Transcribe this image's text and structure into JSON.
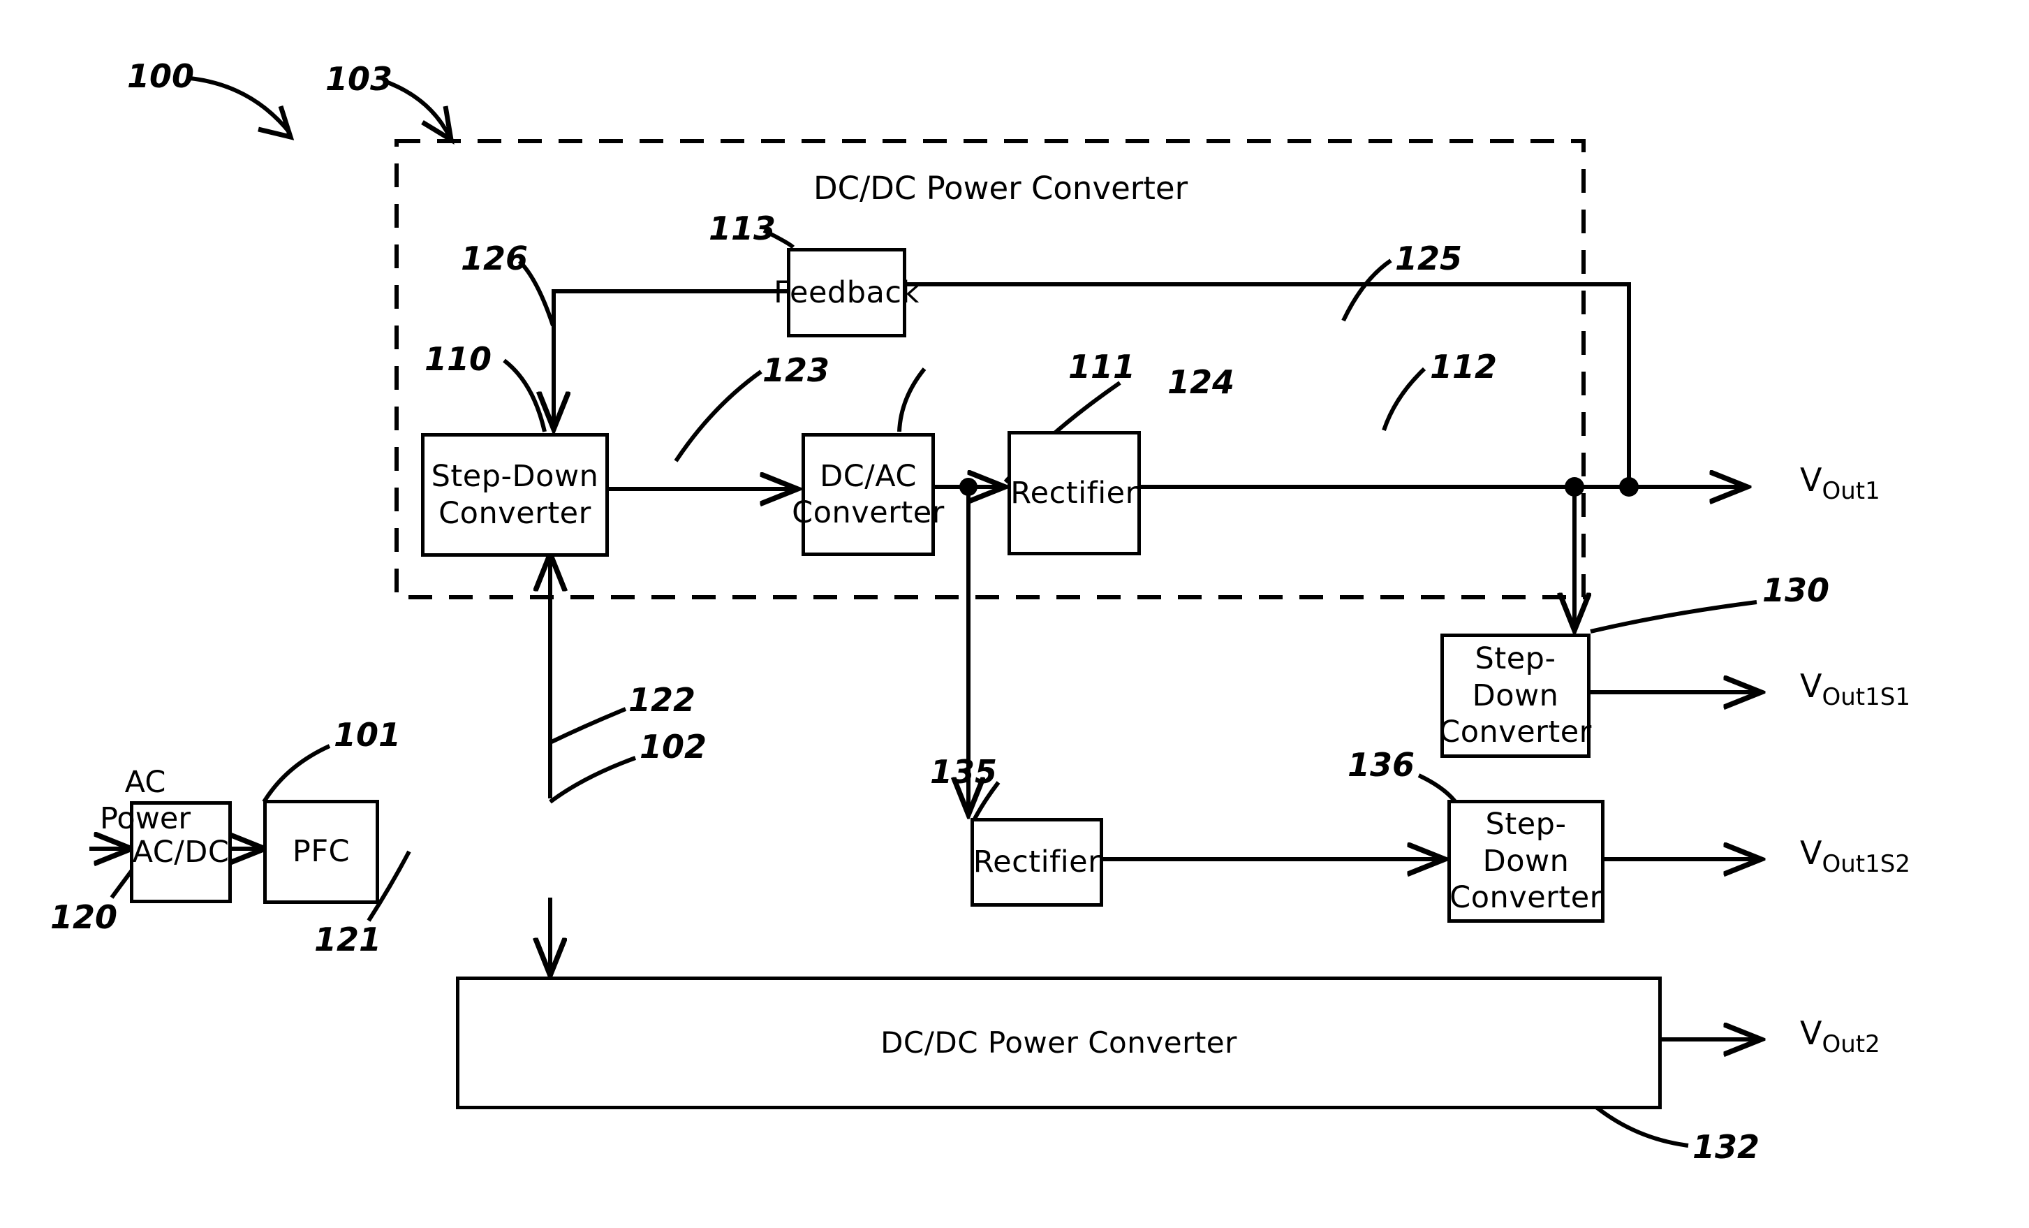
{
  "figure": {
    "kind": "patent-block-diagram",
    "ref_100": "100",
    "ref_103": "103"
  },
  "dashed_module": {
    "title": "DC/DC Power Converter",
    "ref": "103"
  },
  "blocks": {
    "feedback": {
      "label": "Feedback",
      "ref": "113"
    },
    "stepdown110": {
      "label": "Step-Down\nConverter",
      "line1": "Step-Down",
      "line2": "Converter",
      "ref": "110"
    },
    "dcac111": {
      "label": "DC/AC\nConverter",
      "line1": "DC/AC",
      "line2": "Converter",
      "ref": "111"
    },
    "rectifier112": {
      "label": "Rectifier",
      "ref": "112"
    },
    "stepdown130": {
      "line1": "Step-Down",
      "line2": "Converter",
      "ref": "130"
    },
    "acdc101": {
      "label": "AC/DC",
      "ref": "101"
    },
    "pfc102": {
      "label": "PFC",
      "ref": "102"
    },
    "rectifier135": {
      "label": "Rectifier",
      "ref": "135"
    },
    "stepdown136": {
      "line1": "Step-Down",
      "line2": "Converter",
      "ref": "136"
    },
    "dcdc132": {
      "label": "DC/DC Power Converter",
      "ref": "132"
    }
  },
  "signals": {
    "ac_power_line1": "AC",
    "ac_power_line2": "Power",
    "ref_120": "120",
    "ref_121": "121",
    "ref_122": "122",
    "ref_123": "123",
    "ref_124": "124",
    "ref_125": "125",
    "ref_126": "126"
  },
  "outputs": {
    "vout1": {
      "symbol": "V",
      "sub": "Out1"
    },
    "vout1s1": {
      "symbol": "V",
      "sub": "Out1S1"
    },
    "vout1s2": {
      "symbol": "V",
      "sub": "Out1S2"
    },
    "vout2": {
      "symbol": "V",
      "sub": "Out2"
    }
  },
  "colors": {
    "ink": "#000000",
    "paper": "#ffffff"
  }
}
